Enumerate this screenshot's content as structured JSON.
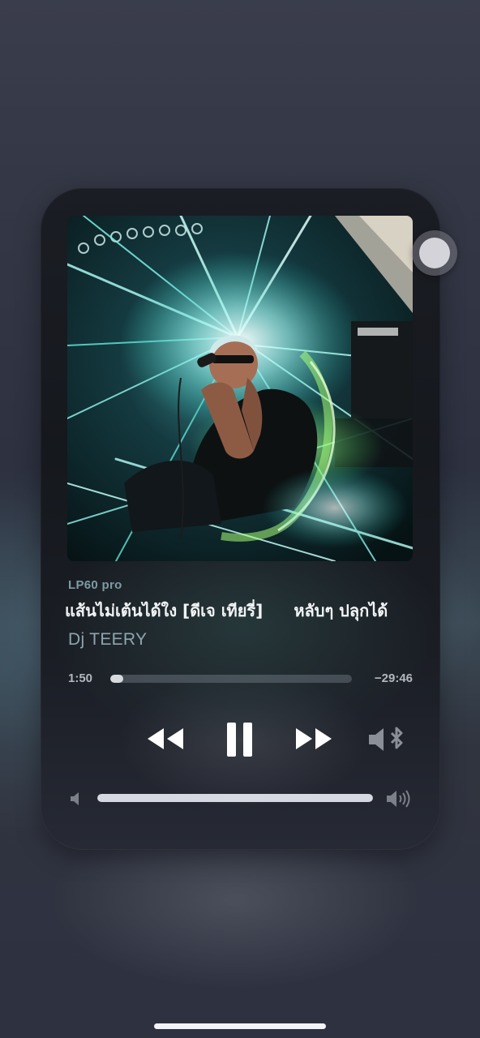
{
  "player": {
    "source": "LP60 pro",
    "title_part1": "แส้นไม่เต้นได้ใง [ดีเจ เทียรี่]",
    "title_part2": "หลับๆ ปลุกได้",
    "artist": "Dj TEERY",
    "time_elapsed": "1:50",
    "time_remaining": "−29:46",
    "progress_fraction": 0.055,
    "volume_fraction": 1.0,
    "state": "playing"
  },
  "icons": {
    "rewind": "backward-icon",
    "play_pause": "pause-icon",
    "forward": "forward-icon",
    "airplay": "speaker-bluetooth-icon",
    "volume_low": "volume-low-icon",
    "volume_high": "volume-high-icon"
  },
  "colors": {
    "accent": "#d7dbe0",
    "source_label": "#7e9aa3",
    "artist": "#8da6ad"
  }
}
